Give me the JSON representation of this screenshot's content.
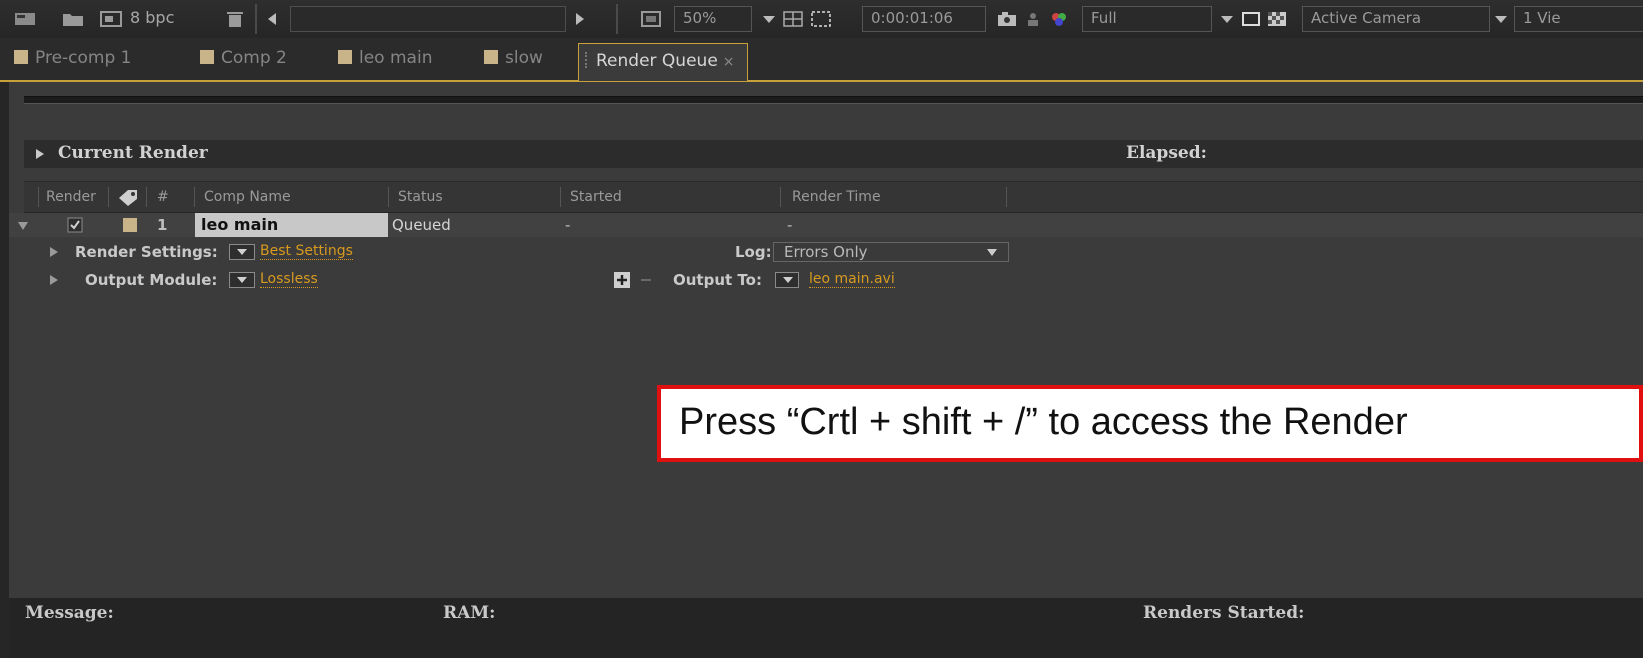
{
  "toolbar": {
    "bit_depth": "8 bpc",
    "zoom": "50%",
    "timecode": "0:00:01:06",
    "resolution": "Full",
    "camera": "Active Camera",
    "views": "1 Vie"
  },
  "tabs": [
    {
      "label": "Pre-comp 1"
    },
    {
      "label": "Comp 2"
    },
    {
      "label": "leo main"
    },
    {
      "label": "slow"
    },
    {
      "label": "Render Queue",
      "close": "×"
    }
  ],
  "current_render": {
    "label": "Current Render",
    "elapsed_label": "Elapsed:"
  },
  "columns": {
    "render": "Render",
    "number": "#",
    "comp_name": "Comp Name",
    "status": "Status",
    "started": "Started",
    "render_time": "Render Time"
  },
  "queue_item": {
    "index": "1",
    "comp_name": "leo main",
    "status": "Queued",
    "started": "-",
    "render_time": "-"
  },
  "render_settings": {
    "label": "Render Settings:",
    "value": "Best Settings",
    "log_label": "Log:",
    "log_value": "Errors Only"
  },
  "output_module": {
    "label": "Output Module:",
    "value": "Lossless",
    "output_to_label": "Output To:",
    "output_to_value": "leo main.avi"
  },
  "callout": {
    "text": "Press “Crtl + shift + /” to access the Render"
  },
  "footer": {
    "message": "Message:",
    "ram": "RAM:",
    "renders_started": "Renders Started:"
  },
  "colors": {
    "accent": "#c7a23a",
    "link": "#d79a1f",
    "callout_border": "#e01010"
  }
}
